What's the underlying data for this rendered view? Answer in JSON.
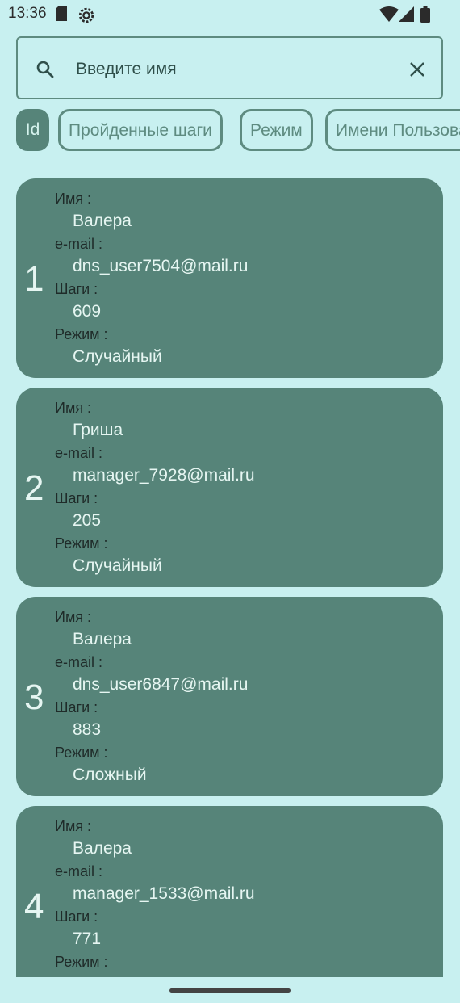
{
  "status_bar": {
    "time": "13:36",
    "icons": [
      "sd-card-icon",
      "settings-gear-icon",
      "wifi-icon",
      "signal-icon",
      "battery-icon"
    ]
  },
  "search": {
    "placeholder": "Введите имя",
    "value": ""
  },
  "sort_chips": [
    {
      "label": "Id",
      "selected": true
    },
    {
      "label": "Пройденные шаги",
      "selected": false
    },
    {
      "label": "Режим",
      "selected": false
    },
    {
      "label": "Имени Пользователя",
      "selected": false
    }
  ],
  "labels": {
    "name": "Имя :",
    "email": "e-mail :",
    "steps": "Шаги :",
    "mode": "Режим :"
  },
  "records": [
    {
      "id": "1",
      "name": "Валера",
      "email": "dns_user7504@mail.ru",
      "steps": "609",
      "mode": "Случайный"
    },
    {
      "id": "2",
      "name": "Гриша",
      "email": "manager_7928@mail.ru",
      "steps": "205",
      "mode": "Случайный"
    },
    {
      "id": "3",
      "name": "Валера",
      "email": "dns_user6847@mail.ru",
      "steps": "883",
      "mode": "Сложный"
    },
    {
      "id": "4",
      "name": "Валера",
      "email": "manager_1533@mail.ru",
      "steps": "771",
      "mode": ""
    }
  ],
  "colors": {
    "background": "#c8f0f0",
    "card": "#568479",
    "accent": "#5e8b80",
    "card_text": "#e6f6f2",
    "label_text": "#1f2b29"
  }
}
